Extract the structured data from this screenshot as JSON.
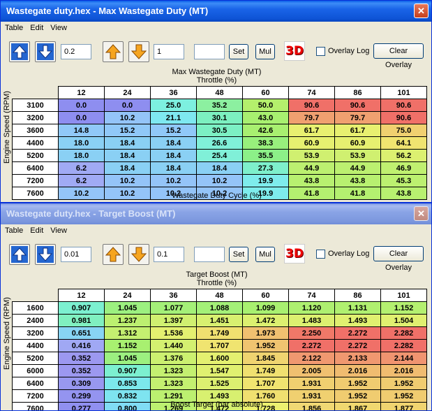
{
  "window1": {
    "title": "Wastegate duty.hex - Max Wastegate Duty (MT)",
    "menu": [
      "Table",
      "Edit",
      "View"
    ],
    "toolbar": {
      "step_value": "0.2",
      "mult_value": "1",
      "set_value": "",
      "set_label": "Set",
      "mul_label": "Mul",
      "btn3d_label": "3D",
      "overlay_label": "Overlay Log",
      "clear_overlay_label": "Clear Overlay"
    },
    "table_title": "Max Wastegate Duty (MT)",
    "x_axis_label": "Throttle (%)",
    "y_axis_label": "Engine Speed (RPM)",
    "bottom_label": "Wastegate Duty Cycle (%)",
    "columns": [
      "12",
      "24",
      "36",
      "48",
      "60",
      "74",
      "86",
      "101"
    ],
    "rows": [
      "3100",
      "3200",
      "3600",
      "4400",
      "5200",
      "6400",
      "7200",
      "7600"
    ],
    "cells": [
      [
        "0.0",
        "0.0",
        "25.0",
        "35.2",
        "50.0",
        "90.6",
        "90.6",
        "90.6"
      ],
      [
        "0.0",
        "10.2",
        "21.1",
        "30.1",
        "43.0",
        "79.7",
        "79.7",
        "90.6"
      ],
      [
        "14.8",
        "15.2",
        "15.2",
        "30.5",
        "42.6",
        "61.7",
        "61.7",
        "75.0"
      ],
      [
        "18.0",
        "18.4",
        "18.4",
        "26.6",
        "38.3",
        "60.9",
        "60.9",
        "64.1"
      ],
      [
        "18.0",
        "18.4",
        "18.4",
        "25.4",
        "35.5",
        "53.9",
        "53.9",
        "56.2"
      ],
      [
        "6.2",
        "18.4",
        "18.4",
        "18.4",
        "27.3",
        "44.9",
        "44.9",
        "46.9"
      ],
      [
        "6.2",
        "10.2",
        "10.2",
        "10.2",
        "19.9",
        "43.8",
        "43.8",
        "45.3"
      ],
      [
        "10.2",
        "10.2",
        "10.2",
        "10.2",
        "19.9",
        "41.8",
        "41.8",
        "43.8"
      ]
    ],
    "colors": [
      [
        "#8e8ef0",
        "#8e8ef0",
        "#7df0e0",
        "#8cf0a0",
        "#b4f06c",
        "#f07068",
        "#f07068",
        "#f07068"
      ],
      [
        "#8e8ef0",
        "#94c4f8",
        "#7ee8f0",
        "#7cf0c0",
        "#a8f070",
        "#f0a070",
        "#f0a070",
        "#f07068"
      ],
      [
        "#90c8f8",
        "#90c8f8",
        "#90c8f8",
        "#7cf0c4",
        "#a8f070",
        "#e8f070",
        "#e8f070",
        "#f0d070"
      ],
      [
        "#8ad0f4",
        "#8ad0f4",
        "#8ad0f4",
        "#80f0d8",
        "#98f07c",
        "#e6f070",
        "#e6f070",
        "#f0e470"
      ],
      [
        "#8ad0f4",
        "#8ad0f4",
        "#8ad0f4",
        "#80f0d8",
        "#8cf088",
        "#d0f070",
        "#d0f070",
        "#dcf070"
      ],
      [
        "#a0aaf4",
        "#8ad0f4",
        "#8ad0f4",
        "#8ad0f4",
        "#7ef0cc",
        "#bcf070",
        "#bcf070",
        "#c0f070"
      ],
      [
        "#a0aaf4",
        "#94c4f8",
        "#94c4f8",
        "#94c4f8",
        "#7eecec",
        "#b8f070",
        "#b8f070",
        "#bcf070"
      ],
      [
        "#94c4f8",
        "#94c4f8",
        "#94c4f8",
        "#94c4f8",
        "#7eecec",
        "#b4f070",
        "#b4f070",
        "#b8f070"
      ]
    ]
  },
  "window2": {
    "title": "Wastegate duty.hex - Target Boost (MT)",
    "menu": [
      "Table",
      "Edit",
      "View"
    ],
    "toolbar": {
      "step_value": "0.01",
      "mult_value": "0.1",
      "set_value": "",
      "set_label": "Set",
      "mul_label": "Mul",
      "btn3d_label": "3D",
      "overlay_label": "Overlay Log",
      "clear_overlay_label": "Clear Overlay"
    },
    "table_title": "Target Boost (MT)",
    "x_axis_label": "Throttle (%)",
    "y_axis_label": "Engine Speed (RPM)",
    "bottom_label": "Boost Target (bar absolute)",
    "columns": [
      "12",
      "24",
      "36",
      "48",
      "60",
      "74",
      "86",
      "101"
    ],
    "rows": [
      "1600",
      "2400",
      "3200",
      "4400",
      "5200",
      "6000",
      "6400",
      "7200",
      "7600"
    ],
    "cells": [
      [
        "0.907",
        "1.045",
        "1.077",
        "1.088",
        "1.099",
        "1.120",
        "1.131",
        "1.152"
      ],
      [
        "0.981",
        "1.237",
        "1.397",
        "1.451",
        "1.472",
        "1.483",
        "1.493",
        "1.504"
      ],
      [
        "0.651",
        "1.312",
        "1.536",
        "1.749",
        "1.973",
        "2.250",
        "2.272",
        "2.282"
      ],
      [
        "0.416",
        "1.152",
        "1.440",
        "1.707",
        "1.952",
        "2.272",
        "2.272",
        "2.282"
      ],
      [
        "0.352",
        "1.045",
        "1.376",
        "1.600",
        "1.845",
        "2.122",
        "2.133",
        "2.144"
      ],
      [
        "0.352",
        "0.907",
        "1.323",
        "1.547",
        "1.749",
        "2.005",
        "2.016",
        "2.016"
      ],
      [
        "0.309",
        "0.853",
        "1.323",
        "1.525",
        "1.707",
        "1.931",
        "1.952",
        "1.952"
      ],
      [
        "0.299",
        "0.832",
        "1.291",
        "1.493",
        "1.760",
        "1.931",
        "1.952",
        "1.952"
      ],
      [
        "0.277",
        "0.800",
        "1.269",
        "1.472",
        "1.728",
        "1.856",
        "1.867",
        "1.877"
      ]
    ],
    "colors": [
      [
        "#7cf0d0",
        "#9cf080",
        "#a4f078",
        "#a4f078",
        "#a8f070",
        "#aef070",
        "#b0f070",
        "#b4f070"
      ],
      [
        "#80f0c0",
        "#bcf070",
        "#d0f070",
        "#d8f070",
        "#dcf070",
        "#dcf070",
        "#e0f070",
        "#e0f070"
      ],
      [
        "#88d4f4",
        "#c4f070",
        "#e4f070",
        "#f0e070",
        "#f0c070",
        "#f07868",
        "#f07068",
        "#f07068"
      ],
      [
        "#a0a8f4",
        "#a8f070",
        "#d4f070",
        "#f0e470",
        "#f0c470",
        "#f07068",
        "#f07068",
        "#f07068"
      ],
      [
        "#9c98f0",
        "#9cf080",
        "#ccf070",
        "#e4f070",
        "#f0d470",
        "#f09870",
        "#f09870",
        "#f09470"
      ],
      [
        "#9c98f0",
        "#7cf0d0",
        "#c4f070",
        "#e0f070",
        "#f0e070",
        "#f0c070",
        "#f0bc70",
        "#f0bc70"
      ],
      [
        "#9898f0",
        "#7ce8ec",
        "#c4f070",
        "#dcf070",
        "#f0e470",
        "#f0d070",
        "#f0cc70",
        "#f0cc70"
      ],
      [
        "#9494f0",
        "#7ee4f0",
        "#bcf070",
        "#d8f070",
        "#f0e070",
        "#f0d070",
        "#f0cc70",
        "#f0cc70"
      ],
      [
        "#9090f0",
        "#80dcf4",
        "#bcf070",
        "#d4f070",
        "#ecf070",
        "#f0d874",
        "#f0d870",
        "#f0d470"
      ]
    ]
  }
}
